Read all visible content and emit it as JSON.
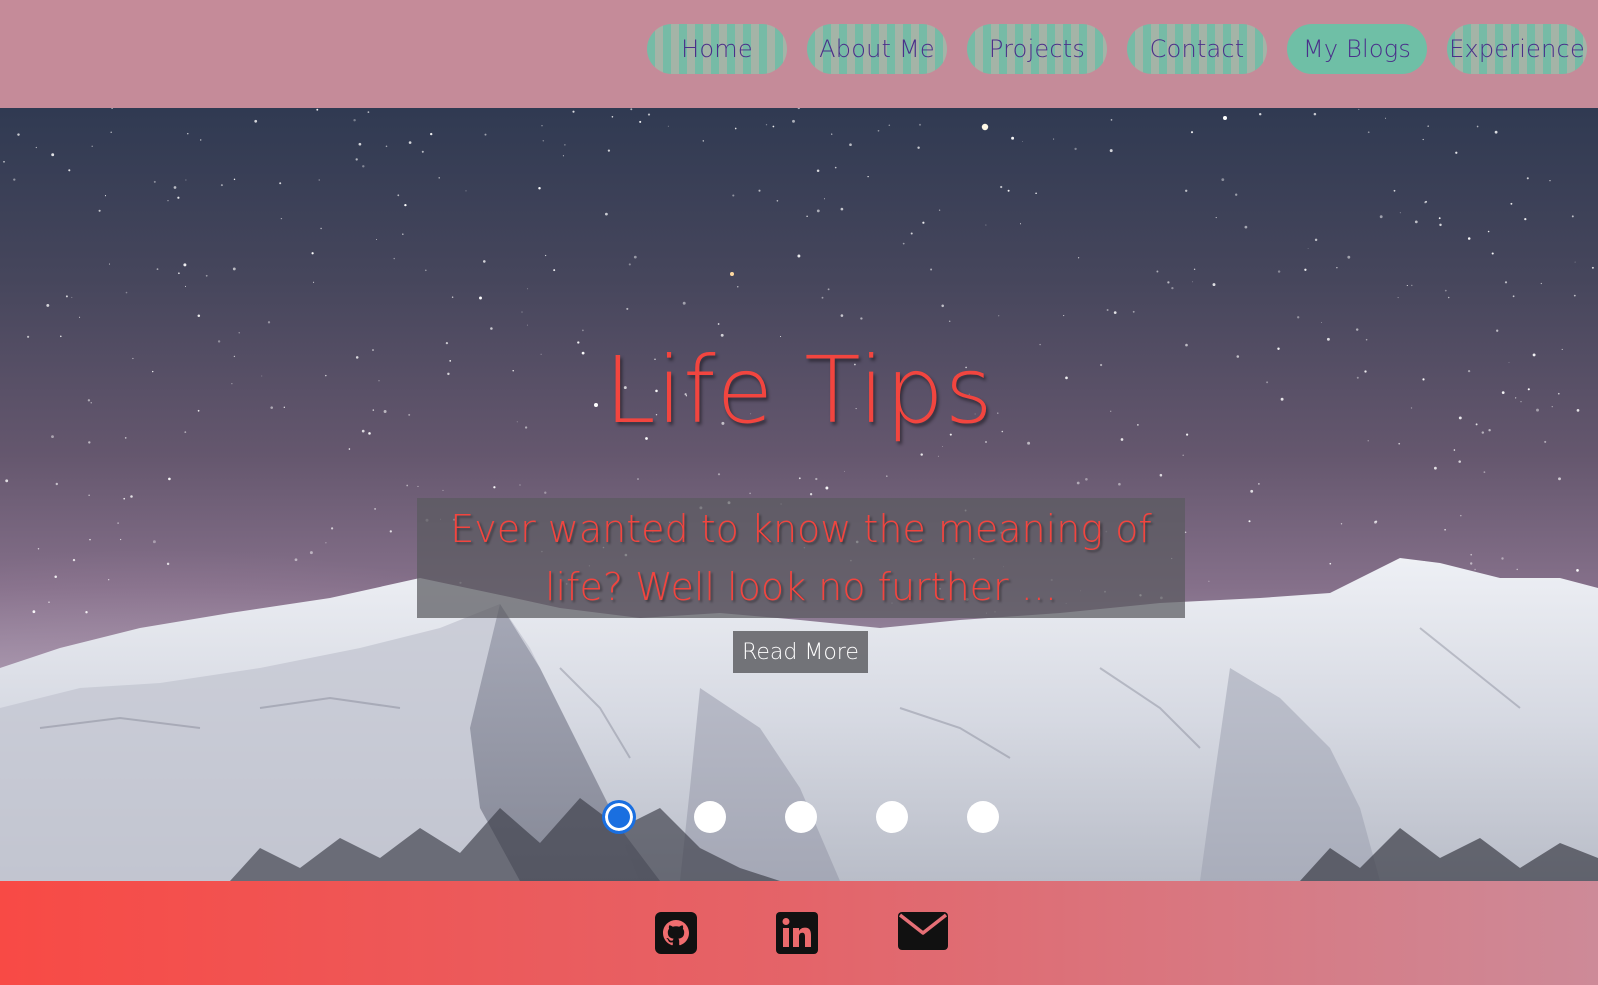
{
  "nav": {
    "items": [
      {
        "label": "Home",
        "active": false
      },
      {
        "label": "About Me",
        "active": false
      },
      {
        "label": "Projects",
        "active": false
      },
      {
        "label": "Contact",
        "active": false
      },
      {
        "label": "My Blogs",
        "active": true
      },
      {
        "label": "Experience",
        "active": false
      }
    ]
  },
  "hero": {
    "title": "Life Tips",
    "caption": "Ever wanted to know the meaning of life? Well look no further ...",
    "read_more_label": "Read More",
    "slide_count": 5,
    "active_slide": 1
  },
  "footer": {
    "icons": [
      "github-icon",
      "linkedin-icon",
      "email-icon"
    ]
  },
  "colors": {
    "nav_bg": "#c58b99",
    "nav_text": "#4a2f8a",
    "nav_accent": "#6fbfa6",
    "title_red": "#f2453f",
    "dot_active": "#1a6fe0",
    "footer_left": "#f84a45",
    "footer_right": "#cd8a98"
  }
}
